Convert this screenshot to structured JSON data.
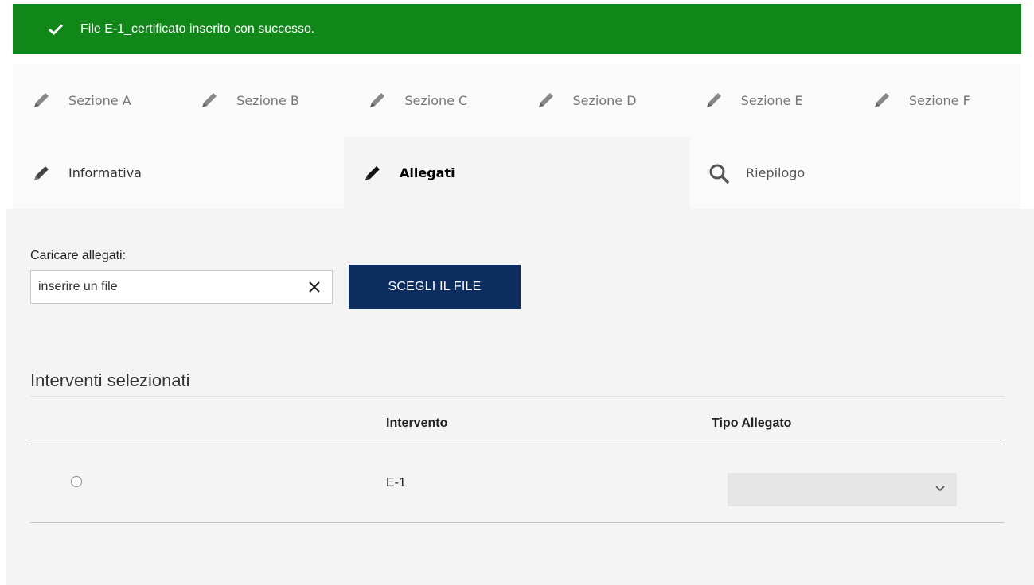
{
  "alert": {
    "message": "File E-1_certificato inserito con successo.",
    "icon": "check-icon",
    "color": "#118619"
  },
  "tabs_row1": [
    {
      "label": "Sezione A",
      "icon": "pencil-icon"
    },
    {
      "label": "Sezione B",
      "icon": "pencil-icon"
    },
    {
      "label": "Sezione C",
      "icon": "pencil-icon"
    },
    {
      "label": "Sezione D",
      "icon": "pencil-icon"
    },
    {
      "label": "Sezione E",
      "icon": "pencil-icon"
    },
    {
      "label": "Sezione F",
      "icon": "pencil-icon"
    }
  ],
  "tabs_row2": [
    {
      "label": "Informativa",
      "icon": "pencil-icon"
    },
    {
      "label": "Allegati",
      "icon": "pencil-icon",
      "active": true
    },
    {
      "label": "Riepilogo",
      "icon": "search-icon"
    }
  ],
  "upload": {
    "label": "Caricare allegati:",
    "placeholder": "inserire un file",
    "button": "SCEGLI IL FILE",
    "button_color": "#0c2d5e"
  },
  "interventi": {
    "title": "Interventi selezionati",
    "columns": [
      "Intervento",
      "Tipo Allegato"
    ],
    "rows": [
      {
        "intervento": "E-1",
        "tipo_allegato": ""
      }
    ]
  }
}
